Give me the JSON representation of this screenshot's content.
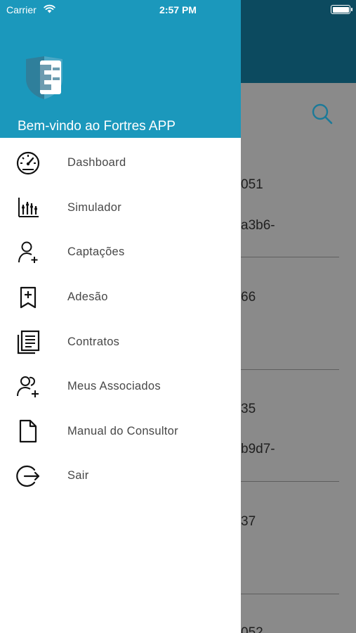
{
  "status_bar": {
    "carrier": "Carrier",
    "time": "2:57 PM"
  },
  "drawer": {
    "welcome": "Bem-vindo ao Fortres APP",
    "items": [
      {
        "label": "Dashboard",
        "icon": "speedometer-icon"
      },
      {
        "label": "Simulador",
        "icon": "chart-bars-icon"
      },
      {
        "label": "Captações",
        "icon": "user-add-icon"
      },
      {
        "label": "Adesão",
        "icon": "bookmark-add-icon"
      },
      {
        "label": "Contratos",
        "icon": "documents-icon"
      },
      {
        "label": "Meus Associados",
        "icon": "users-add-icon"
      },
      {
        "label": "Manual do Consultor",
        "icon": "file-icon"
      },
      {
        "label": "Sair",
        "icon": "logout-icon"
      }
    ]
  },
  "background_list": {
    "fragments": [
      "051",
      "a3b6-",
      "66",
      "35",
      "b9d7-",
      "37",
      "052"
    ]
  },
  "colors": {
    "drawer_header": "#1b98bc",
    "app_header": "#0c4a5f",
    "overlay": "#8a8a8a"
  }
}
